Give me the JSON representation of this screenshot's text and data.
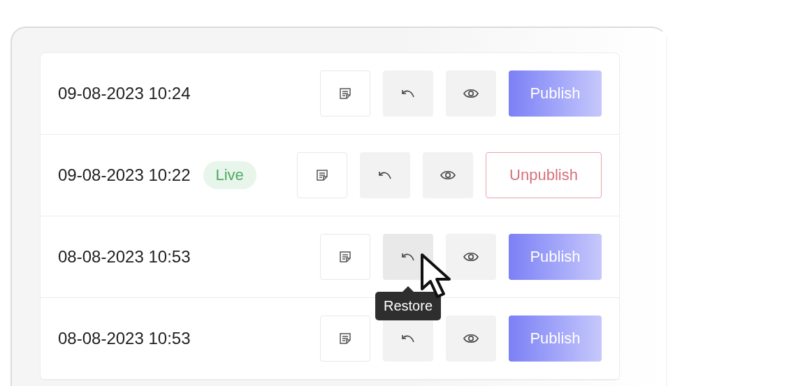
{
  "rows": [
    {
      "date": "09-08-2023 10:24",
      "live": false,
      "restore_hovered": false,
      "action": {
        "kind": "publish",
        "label": "Publish"
      }
    },
    {
      "date": "09-08-2023 10:22",
      "live": true,
      "live_label": "Live",
      "restore_hovered": false,
      "action": {
        "kind": "unpublish",
        "label": "Unpublish"
      }
    },
    {
      "date": "08-08-2023 10:53",
      "live": false,
      "restore_hovered": true,
      "tooltip": "Restore",
      "action": {
        "kind": "publish",
        "label": "Publish"
      }
    },
    {
      "date": "08-08-2023 10:53",
      "live": false,
      "restore_hovered": false,
      "action": {
        "kind": "publish",
        "label": "Publish"
      }
    }
  ]
}
